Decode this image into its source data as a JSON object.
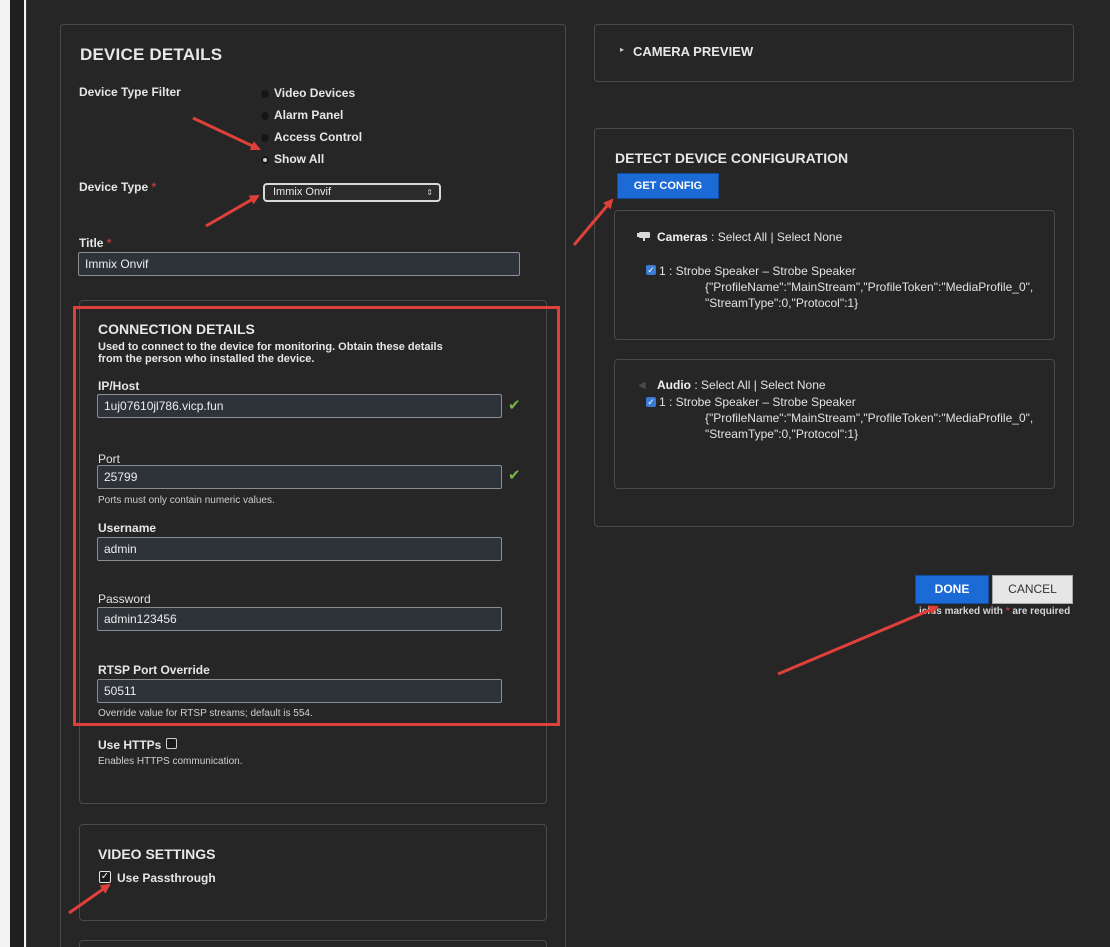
{
  "device_details": {
    "title": "DEVICE DETAILS",
    "filter_label": "Device Type Filter",
    "filter_options": [
      "Video Devices",
      "Alarm Panel",
      "Access Control",
      "Show All"
    ],
    "filter_selected_index": 3,
    "device_type_label": "Device Type",
    "device_type_value": "Immix Onvif",
    "title_label": "Title",
    "title_value": "Immix Onvif",
    "required_mark": "*"
  },
  "connection": {
    "title": "CONNECTION DETAILS",
    "description_line1": "Used to connect to the device for monitoring. Obtain these details",
    "description_line2": "from the person who installed the device.",
    "ip_label": "IP/Host",
    "ip_value": "1uj07610jl786.vicp.fun",
    "port_label": "Port",
    "port_value": "25799",
    "port_hint": "Ports must only contain numeric values.",
    "username_label": "Username",
    "username_value": "admin",
    "password_label": "Password",
    "password_value": "admin123456",
    "rtsp_label": "RTSP Port Override",
    "rtsp_value": "50511",
    "rtsp_hint": "Override value for RTSP streams; default is 554.",
    "https_label": "Use HTTPs",
    "https_hint": "Enables HTTPS communication.",
    "valid_mark": "✔"
  },
  "video_settings": {
    "title": "VIDEO SETTINGS",
    "passthrough_label": "Use Passthrough",
    "passthrough_mark": "✓"
  },
  "camera_preview": {
    "title": "CAMERA PREVIEW",
    "caret": "▸"
  },
  "detect": {
    "title": "DETECT DEVICE CONFIGURATION",
    "get_config_label": "GET CONFIG",
    "cameras": {
      "label": "Cameras",
      "sep": ":",
      "select_all": "Select All",
      "divider": "|",
      "select_none": "Select None",
      "item_line1": "1 : Strobe Speaker – Strobe Speaker",
      "item_line2": "{\"ProfileName\":\"MainStream\",\"ProfileToken\":\"MediaProfile_0\",",
      "item_line3": "\"StreamType\":0,\"Protocol\":1}"
    },
    "audio": {
      "label": "Audio",
      "sep": ":",
      "select_all": "Select All",
      "divider": "|",
      "select_none": "Select None",
      "item_line1": "1 : Strobe Speaker – Strobe Speaker",
      "item_line2": "{\"ProfileName\":\"MainStream\",\"ProfileToken\":\"MediaProfile_0\",",
      "item_line3": "\"StreamType\":0,\"Protocol\":1}"
    },
    "checkbox_mark": "✓"
  },
  "actions": {
    "done_label": "DONE",
    "cancel_label": "CANCEL",
    "required_note_prefix": "ields marked with",
    "required_note_suffix": "are required"
  },
  "colors": {
    "background": "#262626",
    "panel_border": "#4a4a4a",
    "accent_blue": "#1b6ad6",
    "annotation_red": "#e0403a",
    "valid_green": "#7ab44a"
  }
}
